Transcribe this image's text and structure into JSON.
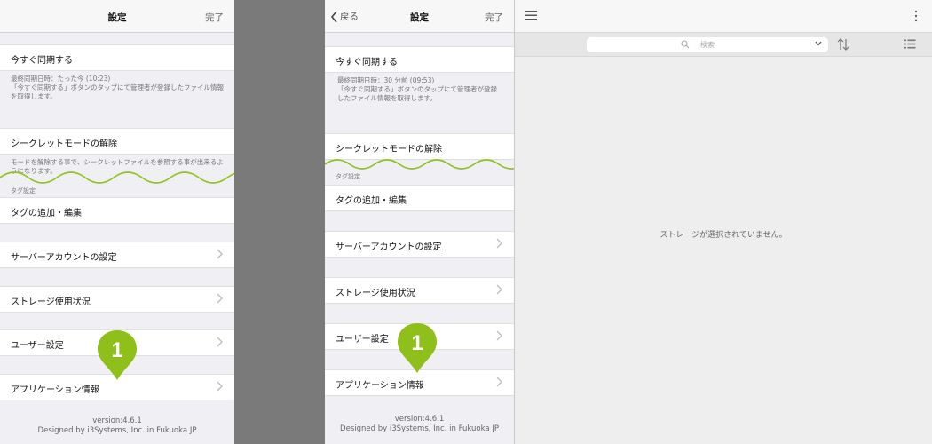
{
  "left": {
    "nav": {
      "title": "設定",
      "done": "完了"
    },
    "sync_label": "今すぐ同期する",
    "sync_footer_1": "最終同期日時：たった今 (10:23)",
    "sync_footer_2": "「今すぐ同期する」ボタンのタップにて管理者が登録したファイル情報を取得します。",
    "secret_label": "シークレットモードの解除",
    "secret_footer": "モードを解除する事で、シークレットファイルを参照する事が出来るようになります。",
    "tag_section": "タグ設定",
    "tag_label": "タグの追加・編集",
    "server_label": "サーバーアカウントの設定",
    "storage_label": "ストレージ使用状況",
    "user_label": "ユーザー設定",
    "app_label": "アプリケーション情報",
    "marker": "1",
    "version": "version:4.6.1",
    "designed": "Designed by i3Systems, Inc. in Fukuoka JP"
  },
  "middle": {
    "nav": {
      "back": "戻る",
      "title": "設定",
      "done": "完了"
    },
    "sync_label": "今すぐ同期する",
    "sync_footer_1": "最終同期日時：30 分前 (09:53)",
    "sync_footer_2": "「今すぐ同期する」ボタンのタップにて管理者が登録したファイル情報を取得します。",
    "secret_label": "シークレットモードの解除",
    "tag_section": "タグ設定",
    "tag_label": "タグの追加・編集",
    "server_label": "サーバーアカウントの設定",
    "storage_label": "ストレージ使用状況",
    "user_label": "ユーザー設定",
    "app_label": "アプリケーション情報",
    "marker": "1",
    "version": "version:4.6.1",
    "designed": "Designed by i3Systems, Inc. in Fukuoka JP"
  },
  "right": {
    "search_placeholder": "検索",
    "empty_message": "ストレージが選択されていません。"
  },
  "colors": {
    "marker": "#8fbf1a",
    "wave": "#8fc31f",
    "gutter": "#7a7a7a"
  },
  "icons": [
    "chevron-right-icon",
    "back-chevron-icon",
    "hamburger-menu-icon",
    "kebab-menu-icon",
    "search-icon",
    "dropdown-icon",
    "sort-icon",
    "list-view-icon"
  ]
}
